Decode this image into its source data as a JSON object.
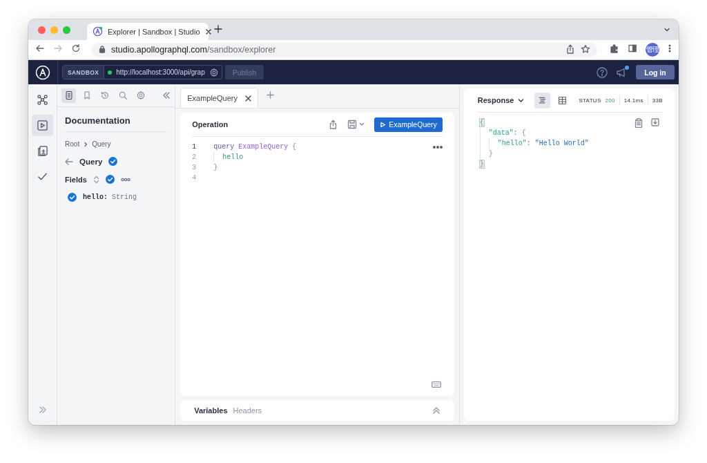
{
  "browser": {
    "tab_title": "Explorer | Sandbox | Studio",
    "url_host": "studio.apollographql.com",
    "url_path": "/sandbox/explorer",
    "avatar": "管理"
  },
  "app_bar": {
    "sandbox_label": "SANDBOX",
    "endpoint": "http://localhost:3000/api/grap",
    "connected": true,
    "publish": {
      "label": "Publish",
      "disabled": true
    },
    "login": "Log in",
    "notification": true
  },
  "rail": [
    {
      "kind": "graph",
      "selected": false
    },
    {
      "kind": "play",
      "selected": true
    },
    {
      "kind": "docs",
      "selected": false
    },
    {
      "kind": "check",
      "selected": false
    }
  ],
  "docs_toolbar": [
    {
      "kind": "docs",
      "selected": true
    },
    {
      "kind": "bookmark",
      "selected": false
    },
    {
      "kind": "history",
      "selected": false
    },
    {
      "kind": "search",
      "selected": false
    },
    {
      "kind": "settings",
      "selected": false
    }
  ],
  "docs": {
    "title": "Documentation",
    "breadcrumb": [
      "Root",
      "Query"
    ],
    "type_name": "Query",
    "type_checked": true,
    "fields_label": "Fields",
    "fields_all_checked": true,
    "fields": [
      {
        "name": "hello:",
        "type": "String",
        "checked": true
      }
    ]
  },
  "editor_tabs": [
    {
      "label": "ExampleQuery",
      "selected": true
    }
  ],
  "operation": {
    "title": "Operation",
    "run_button": "ExampleQuery",
    "lines": [
      {
        "number": "1",
        "active": true,
        "tokens": [
          {
            "kind": "keyword",
            "text": "query"
          },
          {
            "kind": "name",
            "text": "ExampleQuery"
          },
          {
            "kind": "punct",
            "text": "{"
          }
        ]
      },
      {
        "number": "2",
        "active": false,
        "tokens": [
          {
            "kind": "field",
            "text": "  hello"
          }
        ]
      },
      {
        "number": "3",
        "active": false,
        "tokens": [
          {
            "kind": "punct",
            "text": "}"
          }
        ]
      },
      {
        "number": "4",
        "active": false
      }
    ]
  },
  "variables_tabs": [
    {
      "label": "Variables",
      "selected": true
    },
    {
      "label": "Headers",
      "selected": false
    }
  ],
  "response": {
    "title": "Response",
    "views": [
      {
        "kind": "tree",
        "selected": true
      },
      {
        "kind": "table",
        "selected": false
      }
    ],
    "status_label": "STATUS",
    "status_code": "200",
    "time": "14.1ms",
    "size": "33B",
    "lines": [
      {
        "tokens": [
          {
            "kind": "match",
            "text": "{"
          }
        ]
      },
      {
        "tokens": [
          {
            "kind": "key",
            "text": "  \"data\":"
          },
          {
            "kind": "punct",
            "text": "{"
          }
        ]
      },
      {
        "tokens": [
          {
            "kind": "key",
            "text": "    \"hello\":"
          },
          {
            "kind": "string",
            "text": "\"Hello World\""
          }
        ]
      },
      {
        "tokens": [
          {
            "kind": "punct",
            "text": "  }"
          }
        ]
      },
      {
        "tokens": [
          {
            "kind": "match",
            "text": "}"
          }
        ]
      }
    ]
  }
}
